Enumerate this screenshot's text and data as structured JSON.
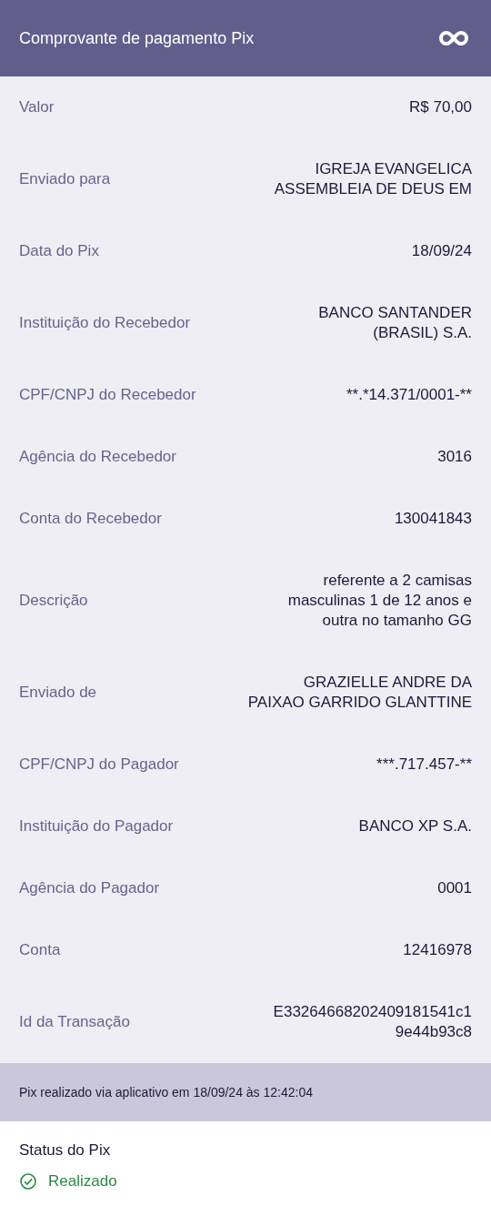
{
  "header": {
    "title": "Comprovante de pagamento Pix"
  },
  "details": [
    {
      "label": "Valor",
      "value": "R$ 70,00"
    },
    {
      "label": "Enviado para",
      "value": "IGREJA EVANGELICA\nASSEMBLEIA DE DEUS EM"
    },
    {
      "label": "Data do Pix",
      "value": "18/09/24"
    },
    {
      "label": "Instituição do Recebedor",
      "value": "BANCO SANTANDER\n(BRASIL) S.A."
    },
    {
      "label": "CPF/CNPJ do Recebedor",
      "value": "**.*14.371/0001-**"
    },
    {
      "label": "Agência do Recebedor",
      "value": "3016"
    },
    {
      "label": "Conta do Recebedor",
      "value": "130041843"
    },
    {
      "label": "Descrição",
      "value": "referente a 2 camisas\nmasculinas 1 de 12 anos e\noutra no tamanho GG"
    },
    {
      "label": "Enviado de",
      "value": "GRAZIELLE ANDRE DA\nPAIXAO GARRIDO GLANTTINE"
    },
    {
      "label": "CPF/CNPJ do Pagador",
      "value": "***.717.457-**"
    },
    {
      "label": "Instituição do Pagador",
      "value": "BANCO XP S.A."
    },
    {
      "label": "Agência do Pagador",
      "value": "0001"
    },
    {
      "label": "Conta",
      "value": "12416978"
    },
    {
      "label": "Id da Transação",
      "value": "E33264668202409181541c1\n9e44b93c8"
    }
  ],
  "footer_note": "Pix realizado via aplicativo em 18/09/24 às 12:42:04",
  "status": {
    "title": "Status do Pix",
    "value": "Realizado",
    "done": true
  }
}
